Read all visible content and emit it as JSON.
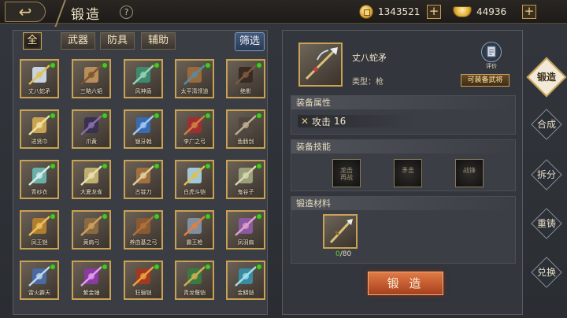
{
  "header": {
    "title": "锻造",
    "help": "?"
  },
  "currency": {
    "coins": {
      "value": "1343521",
      "icon": "coin-icon"
    },
    "gold": {
      "value": "44936",
      "icon": "gold-ingot-icon"
    }
  },
  "tabs": [
    {
      "label": "全",
      "active": true
    },
    {
      "label": "武器",
      "active": false
    },
    {
      "label": "防具",
      "active": false
    },
    {
      "label": "辅助",
      "active": false
    }
  ],
  "filter_label": "筛选",
  "items": [
    {
      "name": "丈八蛇矛",
      "color": "#c8d4e0",
      "accent": "#e0c050"
    },
    {
      "name": "三略六韬",
      "color": "#b98e5a",
      "accent": "#7a5532"
    },
    {
      "name": "风神盾",
      "color": "#3e8a6c",
      "accent": "#9ad0b8"
    },
    {
      "name": "太平清领道",
      "color": "#9a6a3a",
      "accent": "#5a8aa0"
    },
    {
      "name": "绝影",
      "color": "#3a2a22",
      "accent": "#7a5a44"
    },
    {
      "name": "进贤巾",
      "color": "#c9a254",
      "accent": "#f0e2a0"
    },
    {
      "name": "爪黄",
      "color": "#3a3050",
      "accent": "#8870a8"
    },
    {
      "name": "银牙戟",
      "color": "#3a6ab0",
      "accent": "#a0c8f0"
    },
    {
      "name": "李广之弓",
      "color": "#a03030",
      "accent": "#d08040"
    },
    {
      "name": "鱼肠剑",
      "color": "#504840",
      "accent": "#c0b090"
    },
    {
      "name": "青纱衣",
      "color": "#6ab0a8",
      "accent": "#d8eee8"
    },
    {
      "name": "大夏龙雀",
      "color": "#c0b070",
      "accent": "#e8e0b0"
    },
    {
      "name": "古锭刀",
      "color": "#a07040",
      "accent": "#e0d0a0"
    },
    {
      "name": "白虎斗铠",
      "color": "#a0c8d8",
      "accent": "#e0c050"
    },
    {
      "name": "鬼谷子",
      "color": "#9aa07a",
      "accent": "#d8d8b0"
    },
    {
      "name": "凤王铠",
      "color": "#b08030",
      "accent": "#f0c060"
    },
    {
      "name": "黄肩弓",
      "color": "#8a6a40",
      "accent": "#d0a060"
    },
    {
      "name": "养由基之弓",
      "color": "#8a5a30",
      "accent": "#b07040"
    },
    {
      "name": "霸王枪",
      "color": "#8090a0",
      "accent": "#e08040"
    },
    {
      "name": "凤羽扇",
      "color": "#8a5aa0",
      "accent": "#e0a0d0"
    },
    {
      "name": "雷火霹天",
      "color": "#4a6aa0",
      "accent": "#c0d8f0"
    },
    {
      "name": "紫金锤",
      "color": "#8a3aa0",
      "accent": "#e0a0f0"
    },
    {
      "name": "狂骊铠",
      "color": "#a03a20",
      "accent": "#f0a040"
    },
    {
      "name": "青龙偃铠",
      "color": "#3a7a40",
      "accent": "#d0b050"
    },
    {
      "name": "金鳞铠",
      "color": "#3a8aa0",
      "accent": "#a0e0f0"
    }
  ],
  "selected": {
    "name": "丈八蛇矛",
    "type_label": "类型：",
    "type_value": "枪",
    "eval_label": "评价",
    "equip_button": "可装备武将"
  },
  "attributes": {
    "header": "装备属性",
    "stat": {
      "icon": "crossed-swords-icon",
      "label": "攻击",
      "value": "16"
    }
  },
  "skills": {
    "header": "装备技能",
    "items": [
      {
        "label": "龙击\n再战"
      },
      {
        "label": "矛击"
      },
      {
        "label": "战锋"
      }
    ]
  },
  "materials": {
    "header": "锻造材料",
    "have": "0",
    "need": "/80"
  },
  "forge_button": "锻 造",
  "side_nav": [
    {
      "label": "锻造",
      "active": true
    },
    {
      "label": "合成",
      "active": false
    },
    {
      "label": "拆分",
      "active": false
    },
    {
      "label": "重铸",
      "active": false
    },
    {
      "label": "兑换",
      "active": false
    }
  ]
}
